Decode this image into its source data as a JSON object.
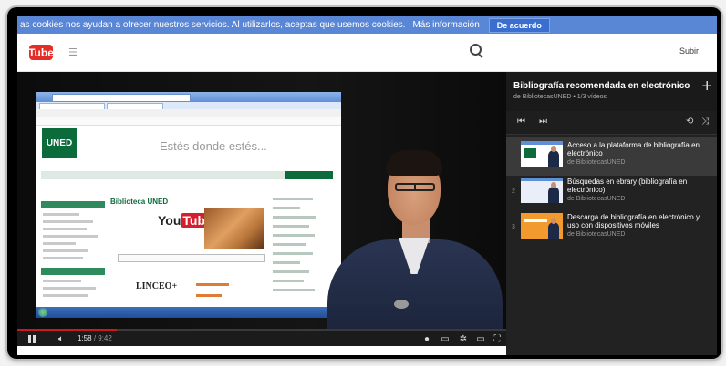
{
  "cookie_banner": {
    "message": "as cookies nos ayudan a ofrecer nuestros servicios. Al utilizarlos, aceptas que usemos cookies.",
    "more_info": "Más información",
    "accept": "De acuerdo"
  },
  "masthead": {
    "logo_text": "Tube",
    "upload": "Subir",
    "icons": [
      "youtube-logo",
      "guide-menu-icon",
      "search-icon"
    ]
  },
  "video": {
    "time_current": "1:58",
    "time_total": "/ 9:42",
    "progress": 0.203,
    "inner_screen": {
      "org_logo": "UNED",
      "slogan": "Estés donde estés...",
      "section_title": "Biblioteca UNED",
      "youtube_word": "You",
      "youtube_tube": "Tube",
      "partner_logo": "LINCEO+"
    }
  },
  "playlist": {
    "title": "Bibliografía recomendada en electrónico",
    "subtitle": "de BibliotecasUNED • 1/3 vídeos",
    "items": [
      {
        "index": "",
        "title": "Acceso a la plataforma de bibliografía en electrónico",
        "author": "de BibliotecasUNED",
        "active": true
      },
      {
        "index": "2",
        "title": "Búsquedas en ebrary (bibliografía en electrónico)",
        "author": "de BibliotecasUNED",
        "active": false
      },
      {
        "index": "3",
        "title": "Descarga de bibliografía en electrónico y uso con dispositivos móviles",
        "author": "de BibliotecasUNED",
        "active": false
      }
    ]
  }
}
